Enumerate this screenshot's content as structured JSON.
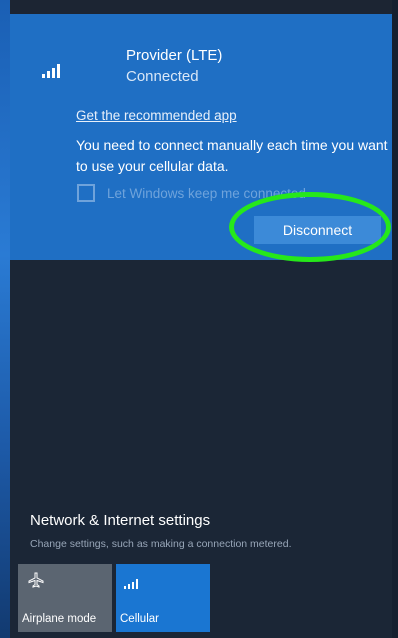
{
  "connection": {
    "icon": "cellular-signal-icon",
    "name": "Provider (LTE)",
    "status": "Connected",
    "app_link": "Get the recommended app",
    "note": "You need to connect manually each time you want to use your cellular data.",
    "auto_connect_label": "Let Windows keep me connected",
    "auto_connect_checked": false,
    "disconnect_label": "Disconnect"
  },
  "settings": {
    "title": "Network & Internet settings",
    "subtitle": "Change settings, such as making a connection metered."
  },
  "quick_actions": [
    {
      "label": "Airplane mode",
      "icon": "airplane-icon",
      "active": false
    },
    {
      "label": "Cellular",
      "icon": "cellular-signal-icon",
      "active": true
    }
  ],
  "colors": {
    "panel": "#1f6fc4",
    "background": "#1b2636",
    "accent_button": "#3c8ad8",
    "highlight_ring": "#26e81a"
  }
}
